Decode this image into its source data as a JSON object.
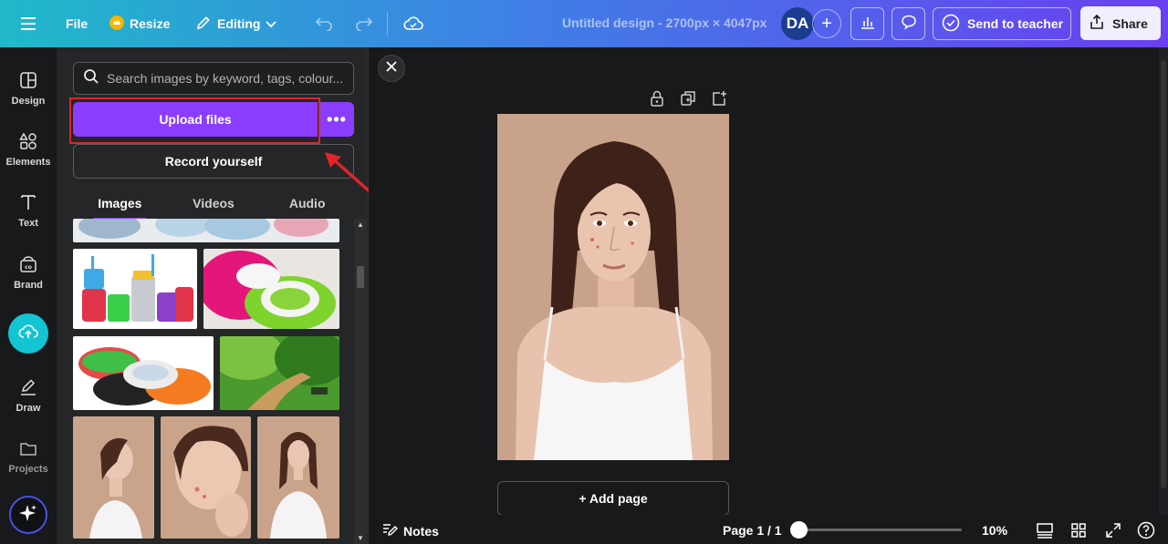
{
  "topbar": {
    "file_label": "File",
    "resize_label": "Resize",
    "editing_label": "Editing",
    "title": "Untitled design - 2700px × 4047px",
    "avatar_initials": "DA",
    "send_teacher_label": "Send to teacher",
    "share_label": "Share"
  },
  "rail": {
    "items": [
      {
        "label": "Design",
        "icon": "design-icon"
      },
      {
        "label": "Elements",
        "icon": "elements-icon"
      },
      {
        "label": "Text",
        "icon": "text-icon"
      },
      {
        "label": "Brand",
        "icon": "brand-icon"
      },
      {
        "label": "",
        "icon": "upload-cloud-icon"
      },
      {
        "label": "Draw",
        "icon": "draw-icon"
      },
      {
        "label": "Projects",
        "icon": "folder-icon"
      },
      {
        "label": "",
        "icon": "magic-sparkle-icon"
      }
    ]
  },
  "panel": {
    "search_placeholder": "Search images by keyword, tags, colour...",
    "upload_label": "Upload files",
    "more_label": "•••",
    "record_label": "Record yourself",
    "tabs": [
      {
        "label": "Images",
        "active": true
      },
      {
        "label": "Videos",
        "active": false
      },
      {
        "label": "Audio",
        "active": false
      }
    ]
  },
  "canvas": {
    "add_page_label": "+ Add page"
  },
  "footer": {
    "notes_label": "Notes",
    "page_label": "Page 1 / 1",
    "zoom_label": "10%",
    "zoom_fraction": 0.1
  },
  "colors": {
    "accent": "#8b3dff",
    "upload_rail": "#13c4d2",
    "highlight": "#e0252b"
  }
}
